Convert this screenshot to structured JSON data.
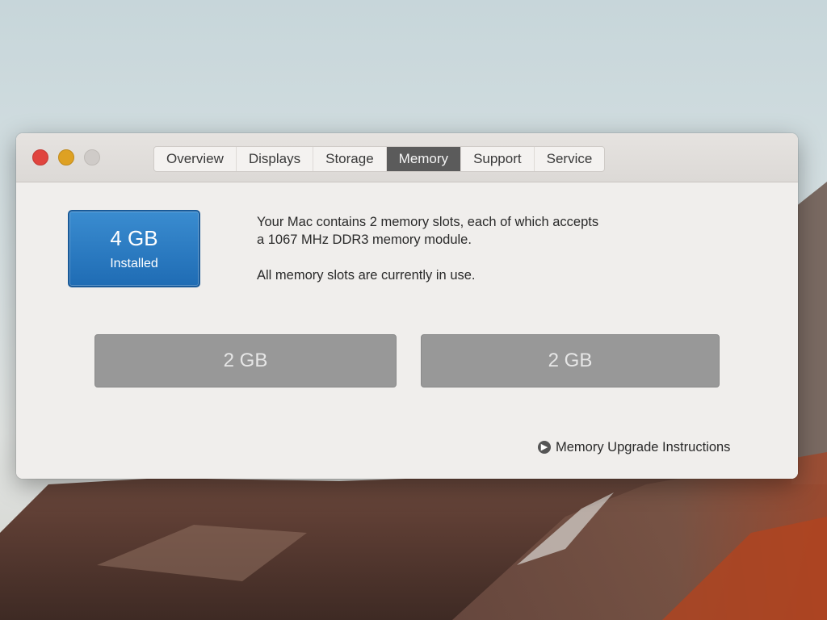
{
  "window": {
    "tabs": [
      {
        "label": "Overview"
      },
      {
        "label": "Displays"
      },
      {
        "label": "Storage"
      },
      {
        "label": "Memory"
      },
      {
        "label": "Support"
      },
      {
        "label": "Service"
      }
    ],
    "selected_tab": "Memory"
  },
  "memory": {
    "installed_size": "4 GB",
    "installed_label": "Installed",
    "info_line1": "Your Mac contains 2 memory slots, each of which accepts",
    "info_line2": "a 1067 MHz DDR3 memory module.",
    "info_line3": "All memory slots are currently in use.",
    "slots": [
      {
        "size": "2 GB"
      },
      {
        "size": "2 GB"
      }
    ],
    "upgrade_link": "Memory Upgrade Instructions",
    "upgrade_icon": "arrow-circle-right-icon"
  },
  "colors": {
    "badge_blue": "#2a7cc4",
    "selected_tab": "#5b5b5b",
    "slot_gray": "#989898",
    "close": "#e0443e",
    "minimize": "#dea123"
  }
}
